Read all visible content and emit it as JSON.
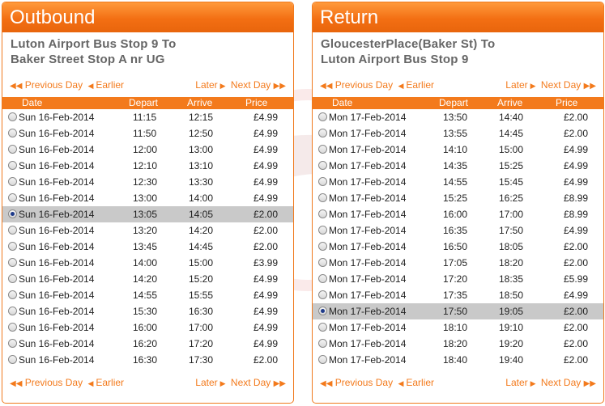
{
  "outbound": {
    "title": "Outbound",
    "route_line1": "Luton Airport Bus Stop 9 To",
    "route_line2": "Baker Street Stop A nr UG",
    "nav": {
      "previous_day": "Previous Day",
      "earlier": "Earlier",
      "later": "Later",
      "next_day": "Next Day"
    },
    "columns": {
      "date": "Date",
      "depart": "Depart",
      "arrive": "Arrive",
      "price": "Price"
    },
    "selected_index": 6,
    "rows": [
      {
        "date": "Sun 16-Feb-2014",
        "depart": "11:15",
        "arrive": "12:15",
        "price": "£4.99"
      },
      {
        "date": "Sun 16-Feb-2014",
        "depart": "11:50",
        "arrive": "12:50",
        "price": "£4.99"
      },
      {
        "date": "Sun 16-Feb-2014",
        "depart": "12:00",
        "arrive": "13:00",
        "price": "£4.99"
      },
      {
        "date": "Sun 16-Feb-2014",
        "depart": "12:10",
        "arrive": "13:10",
        "price": "£4.99"
      },
      {
        "date": "Sun 16-Feb-2014",
        "depart": "12:30",
        "arrive": "13:30",
        "price": "£4.99"
      },
      {
        "date": "Sun 16-Feb-2014",
        "depart": "13:00",
        "arrive": "14:00",
        "price": "£4.99"
      },
      {
        "date": "Sun 16-Feb-2014",
        "depart": "13:05",
        "arrive": "14:05",
        "price": "£2.00"
      },
      {
        "date": "Sun 16-Feb-2014",
        "depart": "13:20",
        "arrive": "14:20",
        "price": "£2.00"
      },
      {
        "date": "Sun 16-Feb-2014",
        "depart": "13:45",
        "arrive": "14:45",
        "price": "£2.00"
      },
      {
        "date": "Sun 16-Feb-2014",
        "depart": "14:00",
        "arrive": "15:00",
        "price": "£3.99"
      },
      {
        "date": "Sun 16-Feb-2014",
        "depart": "14:20",
        "arrive": "15:20",
        "price": "£4.99"
      },
      {
        "date": "Sun 16-Feb-2014",
        "depart": "14:55",
        "arrive": "15:55",
        "price": "£4.99"
      },
      {
        "date": "Sun 16-Feb-2014",
        "depart": "15:30",
        "arrive": "16:30",
        "price": "£4.99"
      },
      {
        "date": "Sun 16-Feb-2014",
        "depart": "16:00",
        "arrive": "17:00",
        "price": "£4.99"
      },
      {
        "date": "Sun 16-Feb-2014",
        "depart": "16:20",
        "arrive": "17:20",
        "price": "£4.99"
      },
      {
        "date": "Sun 16-Feb-2014",
        "depart": "16:30",
        "arrive": "17:30",
        "price": "£2.00"
      }
    ]
  },
  "return": {
    "title": "Return",
    "route_line1": "GloucesterPlace(Baker St) To",
    "route_line2": "Luton Airport Bus Stop 9",
    "nav": {
      "previous_day": "Previous Day",
      "earlier": "Earlier",
      "later": "Later",
      "next_day": "Next Day"
    },
    "columns": {
      "date": "Date",
      "depart": "Depart",
      "arrive": "Arrive",
      "price": "Price"
    },
    "selected_index": 12,
    "rows": [
      {
        "date": "Mon 17-Feb-2014",
        "depart": "13:50",
        "arrive": "14:40",
        "price": "£2.00"
      },
      {
        "date": "Mon 17-Feb-2014",
        "depart": "13:55",
        "arrive": "14:45",
        "price": "£2.00"
      },
      {
        "date": "Mon 17-Feb-2014",
        "depart": "14:10",
        "arrive": "15:00",
        "price": "£4.99"
      },
      {
        "date": "Mon 17-Feb-2014",
        "depart": "14:35",
        "arrive": "15:25",
        "price": "£4.99"
      },
      {
        "date": "Mon 17-Feb-2014",
        "depart": "14:55",
        "arrive": "15:45",
        "price": "£4.99"
      },
      {
        "date": "Mon 17-Feb-2014",
        "depart": "15:25",
        "arrive": "16:25",
        "price": "£8.99"
      },
      {
        "date": "Mon 17-Feb-2014",
        "depart": "16:00",
        "arrive": "17:00",
        "price": "£8.99"
      },
      {
        "date": "Mon 17-Feb-2014",
        "depart": "16:35",
        "arrive": "17:50",
        "price": "£4.99"
      },
      {
        "date": "Mon 17-Feb-2014",
        "depart": "16:50",
        "arrive": "18:05",
        "price": "£2.00"
      },
      {
        "date": "Mon 17-Feb-2014",
        "depart": "17:05",
        "arrive": "18:20",
        "price": "£2.00"
      },
      {
        "date": "Mon 17-Feb-2014",
        "depart": "17:20",
        "arrive": "18:35",
        "price": "£5.99"
      },
      {
        "date": "Mon 17-Feb-2014",
        "depart": "17:35",
        "arrive": "18:50",
        "price": "£4.99"
      },
      {
        "date": "Mon 17-Feb-2014",
        "depart": "17:50",
        "arrive": "19:05",
        "price": "£2.00"
      },
      {
        "date": "Mon 17-Feb-2014",
        "depart": "18:10",
        "arrive": "19:10",
        "price": "£2.00"
      },
      {
        "date": "Mon 17-Feb-2014",
        "depart": "18:20",
        "arrive": "19:20",
        "price": "£2.00"
      },
      {
        "date": "Mon 17-Feb-2014",
        "depart": "18:40",
        "arrive": "19:40",
        "price": "£2.00"
      }
    ]
  },
  "colors": {
    "accent": "#f37a1c",
    "selected_row": "#c9c9c9"
  },
  "icons": {
    "nav_back": "double-left-arrow-icon",
    "nav_forward": "double-right-arrow-icon"
  }
}
